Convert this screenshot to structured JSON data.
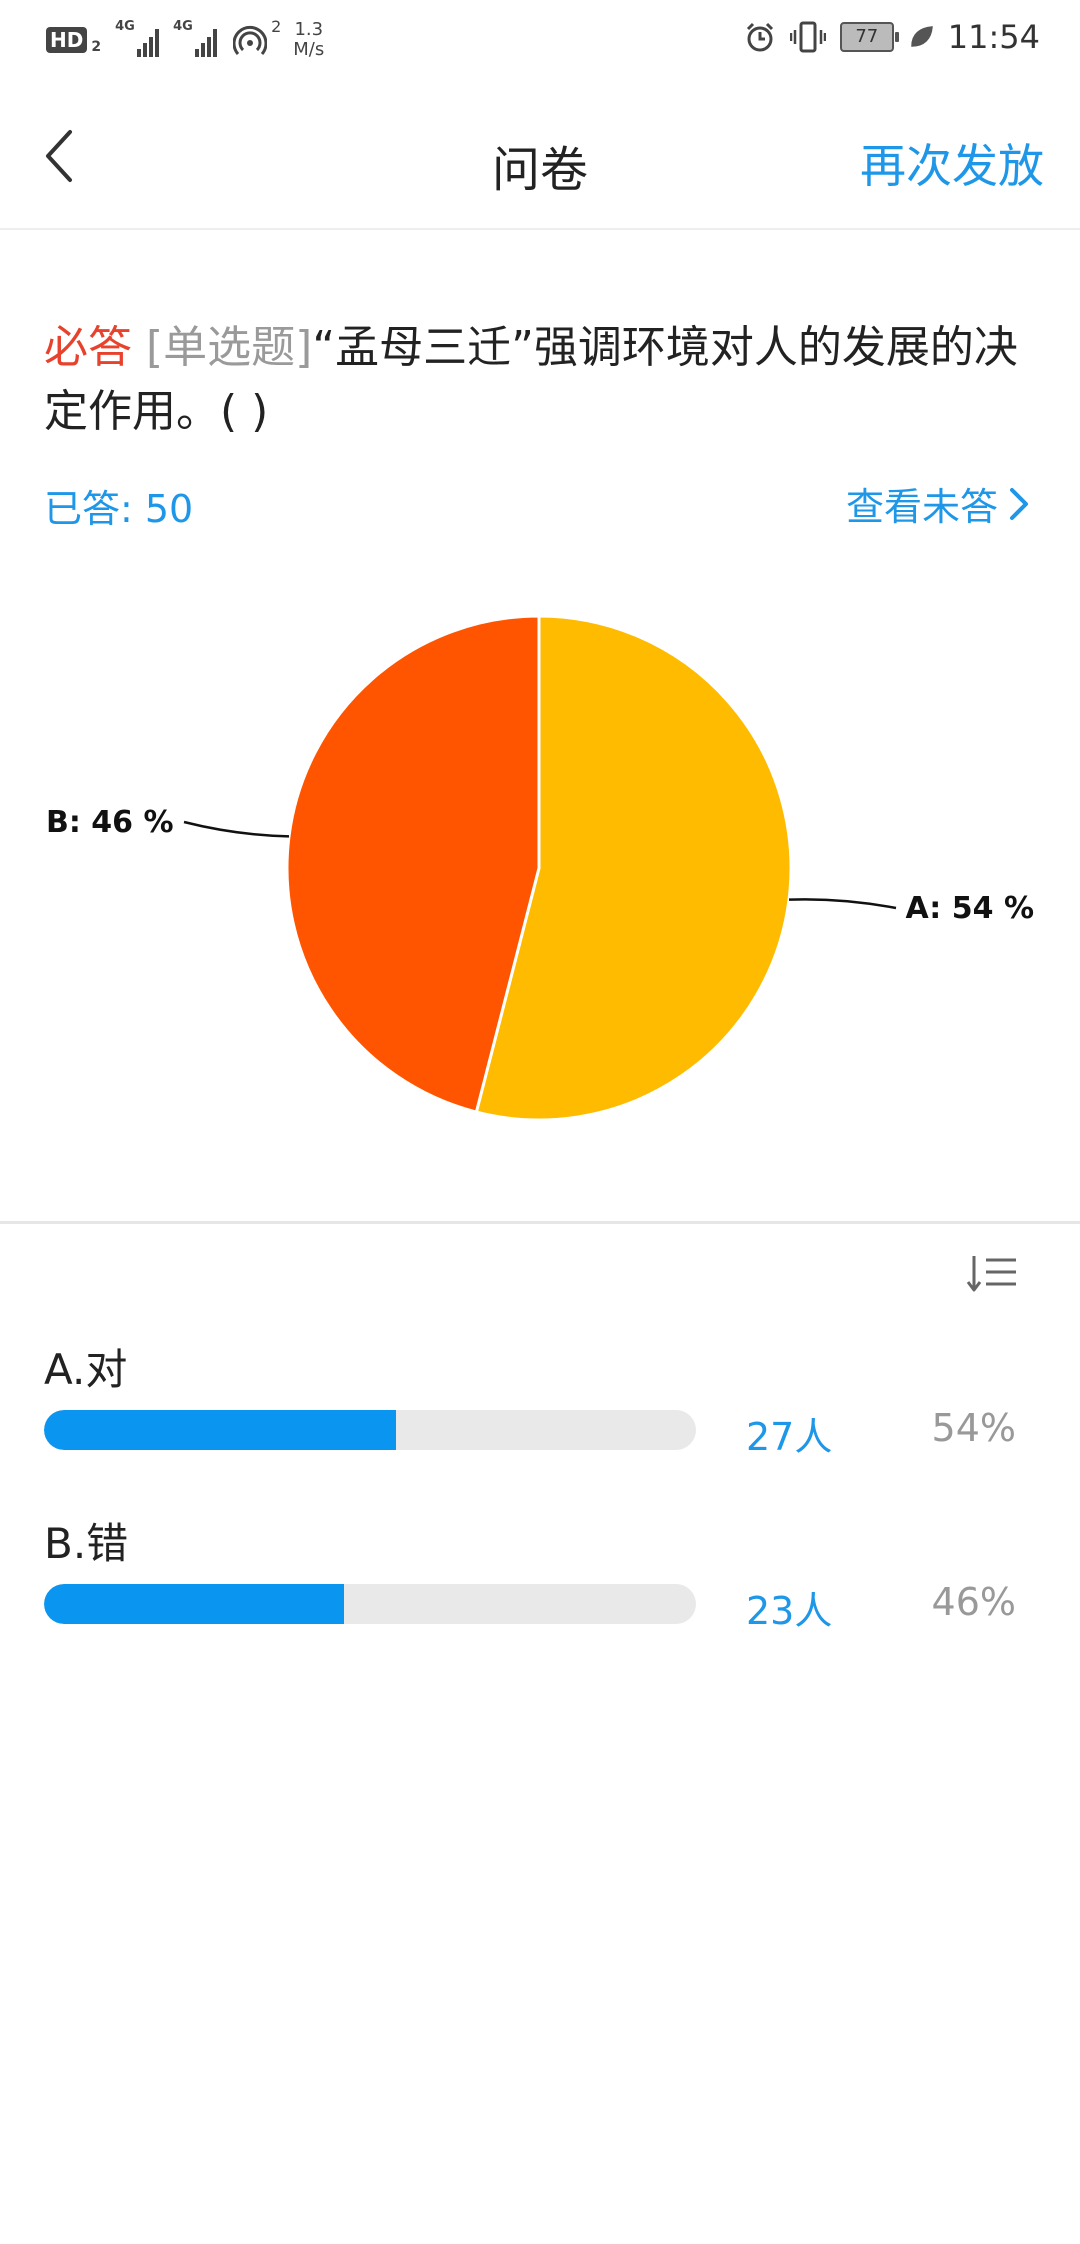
{
  "status_bar": {
    "hd_label": "HD",
    "hd_sub": "2",
    "signal1_label": "4G",
    "signal2_label": "4G",
    "wifi_sup": "2",
    "speed_value": "1.3",
    "speed_unit": "M/s",
    "battery": "77",
    "time": "11:54"
  },
  "header": {
    "title": "问卷",
    "action": "再次发放"
  },
  "question": {
    "required": "必答",
    "type": "[单选题]",
    "text": "“孟母三迁”强调环境对人的发展的决定作用。( )"
  },
  "answered": "已答: 50",
  "view_unanswered": "查看未答",
  "chart_data": {
    "type": "pie",
    "slices": [
      {
        "label": "A: 54 %",
        "value": 54,
        "color": "#ffbb00"
      },
      {
        "label": "B: 46 %",
        "value": 46,
        "color": "#ff5500"
      }
    ]
  },
  "options": [
    {
      "label": "A.对",
      "count": "27人",
      "percent": "54%",
      "fraction": 0.54
    },
    {
      "label": "B.错",
      "count": "23人",
      "percent": "46%",
      "fraction": 0.46
    }
  ],
  "colors": {
    "accent": "#1e97e8",
    "required": "#e8412c",
    "bar": "#0a95f0"
  }
}
